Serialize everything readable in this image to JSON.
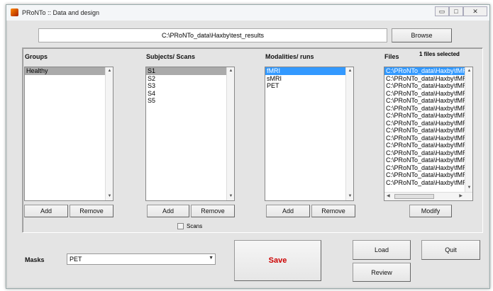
{
  "window": {
    "title": "PRoNTo :: Data and design",
    "minimize": "▭",
    "maximize": "□",
    "close": "✕"
  },
  "path": {
    "value": "C:\\PRoNTo_data\\Haxby\\test_results",
    "browse_label": "Browse"
  },
  "groups": {
    "label": "Groups",
    "items": [
      "Healthy"
    ],
    "add": "Add",
    "remove": "Remove"
  },
  "subjects": {
    "label": "Subjects/ Scans",
    "items": [
      "S1",
      "S2",
      "S3",
      "S4",
      "S5"
    ],
    "add": "Add",
    "remove": "Remove",
    "scans_label": "Scans",
    "scans_checked": false
  },
  "modalities": {
    "label": "Modalities/ runs",
    "items": [
      "fMRI",
      "sMRI",
      "PET"
    ],
    "add": "Add",
    "remove": "Remove"
  },
  "files": {
    "label": "Files",
    "status": "1 files selected",
    "items": [
      "C:\\PRoNTo_data\\Haxby\\fMR",
      "C:\\PRoNTo_data\\Haxby\\fMR",
      "C:\\PRoNTo_data\\Haxby\\fMR",
      "C:\\PRoNTo_data\\Haxby\\fMR",
      "C:\\PRoNTo_data\\Haxby\\fMR",
      "C:\\PRoNTo_data\\Haxby\\fMR",
      "C:\\PRoNTo_data\\Haxby\\fMR",
      "C:\\PRoNTo_data\\Haxby\\fMR",
      "C:\\PRoNTo_data\\Haxby\\fMR",
      "C:\\PRoNTo_data\\Haxby\\fMR",
      "C:\\PRoNTo_data\\Haxby\\fMR",
      "C:\\PRoNTo_data\\Haxby\\fMR",
      "C:\\PRoNTo_data\\Haxby\\fMR",
      "C:\\PRoNTo_data\\Haxby\\fMR",
      "C:\\PRoNTo_data\\Haxby\\fMR",
      "C:\\PRoNTo_data\\Haxby\\fMR"
    ],
    "modify": "Modify"
  },
  "masks": {
    "label": "Masks",
    "selected": "PET"
  },
  "actions": {
    "save": "Save",
    "load": "Load",
    "quit": "Quit",
    "review": "Review"
  },
  "colors": {
    "save_text": "#cc0000",
    "selection": "#3399ff"
  }
}
